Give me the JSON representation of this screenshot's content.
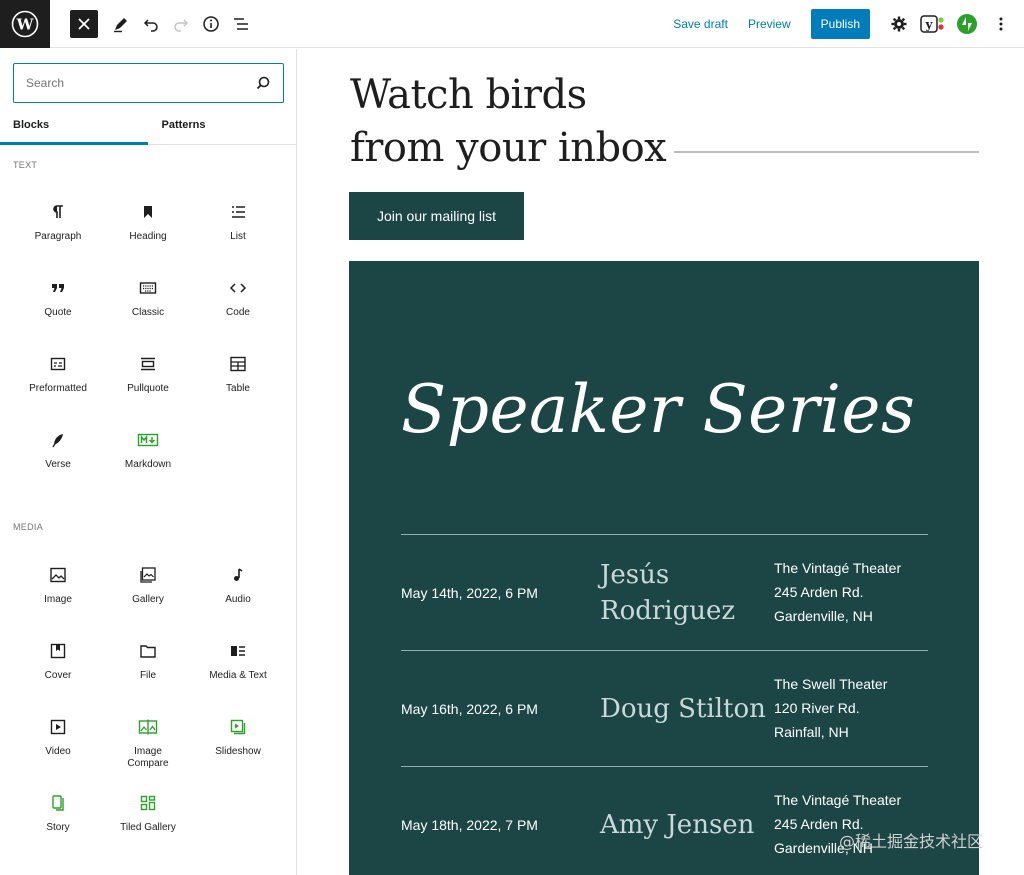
{
  "toolbar": {
    "save_draft": "Save draft",
    "preview": "Preview",
    "publish": "Publish",
    "icons": [
      "wordpress-logo",
      "close-icon",
      "pencil-icon",
      "undo-icon",
      "redo-icon",
      "info-icon",
      "list-view-icon",
      "gear-icon",
      "yoast-icon",
      "jetpack-icon",
      "more-icon"
    ]
  },
  "sidebar": {
    "search_placeholder": "Search",
    "tabs": [
      "Blocks",
      "Patterns"
    ],
    "categories": {
      "text": "TEXT",
      "media": "MEDIA"
    },
    "text_blocks": [
      "Paragraph",
      "Heading",
      "List",
      "Quote",
      "Classic",
      "Code",
      "Preformatted",
      "Pullquote",
      "Table",
      "Verse",
      "Markdown"
    ],
    "media_blocks": [
      "Image",
      "Gallery",
      "Audio",
      "Cover",
      "File",
      "Media & Text",
      "Video",
      "Image\nCompare",
      "Slideshow",
      "Story",
      "Tiled Gallery"
    ]
  },
  "canvas": {
    "heading_line1": "Watch birds",
    "heading_line2": "from your inbox",
    "join_button": "Join our mailing list",
    "speaker_title": "Speaker Series",
    "events": [
      {
        "date": "May 14th, 2022, 6 PM",
        "name_line1": "Jesús",
        "name_line2": "Rodriguez",
        "venue": "The Vintagé Theater",
        "address": "245 Arden Rd.",
        "city": "Gardenville, NH"
      },
      {
        "date": "May 16th, 2022, 6 PM",
        "name_line1": "Doug Stilton",
        "name_line2": "",
        "venue": "The Swell Theater",
        "address": "120 River Rd.",
        "city": "Rainfall, NH"
      },
      {
        "date": "May 18th, 2022, 7 PM",
        "name_line1": "Amy Jensen",
        "name_line2": "",
        "venue": "The Vintagé Theater",
        "address": "245 Arden Rd.",
        "city": "Gardenville, NH"
      }
    ]
  },
  "watermark": "@稀土掘金技术社区",
  "colors": {
    "accent": "#007cba",
    "panel": "#1c4545",
    "green_icon": "#2ba02b"
  }
}
